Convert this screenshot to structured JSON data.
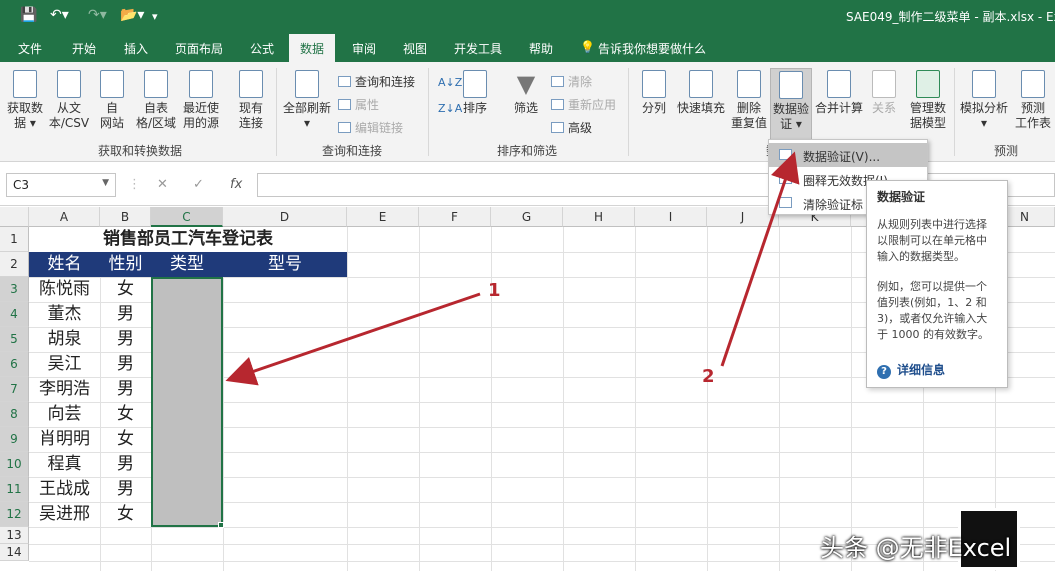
{
  "window": {
    "title": "SAE049_制作二级菜单 - 副本.xlsx  -  Ex"
  },
  "tabs": [
    {
      "label": "文件"
    },
    {
      "label": "开始"
    },
    {
      "label": "插入"
    },
    {
      "label": "页面布局"
    },
    {
      "label": "公式"
    },
    {
      "label": "数据"
    },
    {
      "label": "审阅"
    },
    {
      "label": "视图"
    },
    {
      "label": "开发工具"
    },
    {
      "label": "帮助"
    },
    {
      "label": "告诉我你想要做什么"
    }
  ],
  "ribbon": {
    "get_data": "获取数\n据 ▾",
    "from_text": "从文\n本/CSV",
    "from_web": "自\n网站",
    "from_table": "自表\n格/区域",
    "recent_sources": "最近使\n用的源",
    "existing_conn": "现有\n连接",
    "group_get": "获取和转换数据",
    "refresh_all": "全部刷新\n▾",
    "queries_conn": "查询和连接",
    "properties": "属性",
    "edit_links": "编辑链接",
    "group_queries": "查询和连接",
    "sort": "排序",
    "filter": "筛选",
    "clear": "清除",
    "reapply": "重新应用",
    "advanced": "高级",
    "group_sort": "排序和筛选",
    "text_to_col": "分列",
    "flash_fill": "快速填充",
    "remove_dup": "删除\n重复值",
    "data_validation": "数据验\n证 ▾",
    "consolidate": "合并计算",
    "relationships": "关系",
    "manage_model": "管理数\n据模型",
    "group_tools": "数",
    "what_if": "模拟分析\n▾",
    "forecast_sheet": "预测\n工作表",
    "group_forecast": "预测"
  },
  "formula_bar": {
    "name_box": "C3",
    "cancel": "✕",
    "enter": "✓",
    "fx": "fx",
    "formula": ""
  },
  "columns": [
    "A",
    "B",
    "C",
    "D",
    "E",
    "F",
    "G",
    "H",
    "I",
    "J",
    "K",
    "L",
    "M",
    "N"
  ],
  "rows": [
    "1",
    "2",
    "3",
    "4",
    "5",
    "6",
    "7",
    "8",
    "9",
    "10",
    "11",
    "12",
    "13",
    "14"
  ],
  "sheet": {
    "title": "销售部员工汽车登记表",
    "headers": [
      "姓名",
      "性别",
      "类型",
      "型号"
    ],
    "records": [
      [
        "陈悦雨",
        "女"
      ],
      [
        "董杰",
        "男"
      ],
      [
        "胡泉",
        "男"
      ],
      [
        "吴江",
        "男"
      ],
      [
        "李明浩",
        "男"
      ],
      [
        "向芸",
        "女"
      ],
      [
        "肖明明",
        "女"
      ],
      [
        "程真",
        "男"
      ],
      [
        "王战成",
        "男"
      ],
      [
        "吴进邢",
        "女"
      ]
    ]
  },
  "dropdown": {
    "items": [
      {
        "label": "数据验证(V)..."
      },
      {
        "label": "圈释无效数据(I)"
      },
      {
        "label": "清除验证标"
      }
    ]
  },
  "tooltip": {
    "title": "数据验证",
    "p1": "从规则列表中进行选择以限制可以在单元格中输入的数据类型。",
    "p2": "例如，您可以提供一个值列表(例如，1、2 和 3)，或者仅允许输入大于 1000 的有效数字。",
    "link": "详细信息"
  },
  "annotations": {
    "label1": "1",
    "label2": "2",
    "color": "#b7272f"
  },
  "watermark": {
    "text": "头条 @无非Excel"
  },
  "colors": {
    "excel_green": "#217346",
    "header_fill": "#1f3a7a"
  }
}
